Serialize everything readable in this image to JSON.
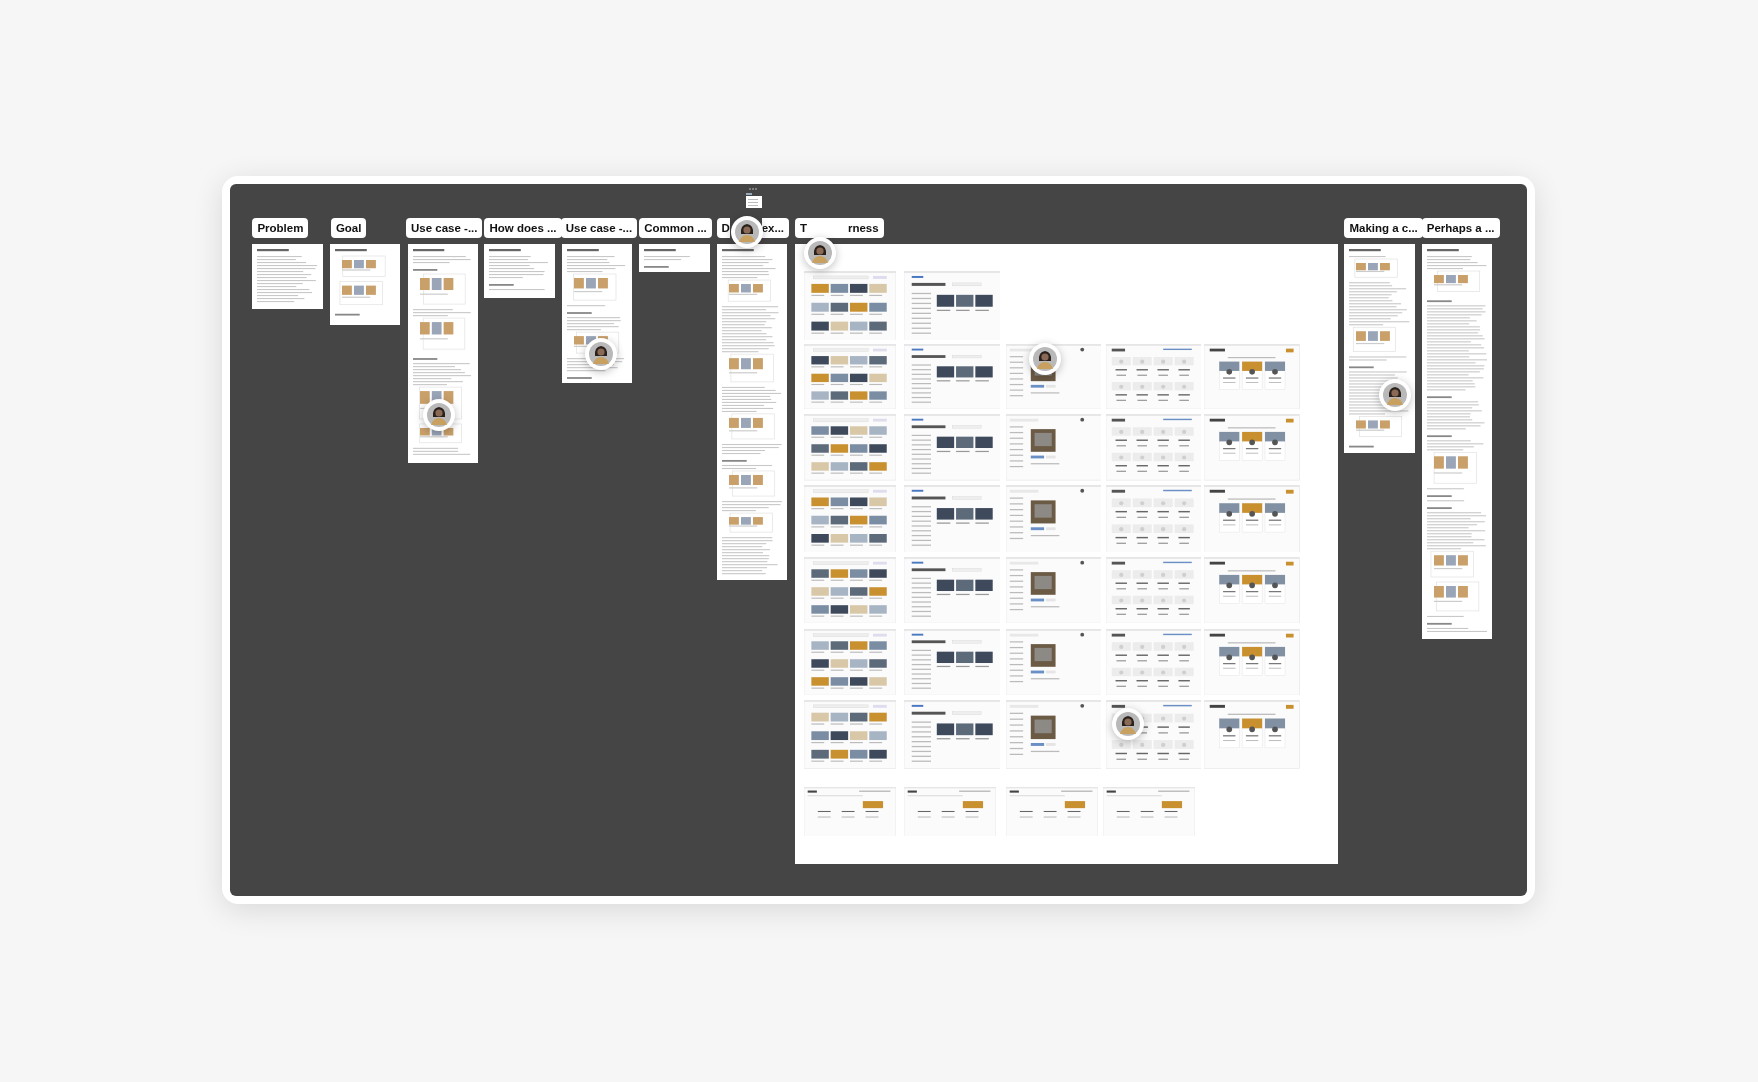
{
  "frames": [
    {
      "title": "Problem",
      "kind": "document"
    },
    {
      "title": "Goal",
      "kind": "document"
    },
    {
      "title": "Use case -...",
      "kind": "document"
    },
    {
      "title": "How does ...",
      "kind": "document"
    },
    {
      "title": "Use case -...",
      "kind": "document"
    },
    {
      "title": "Common ...",
      "kind": "document"
    },
    {
      "title_parts": [
        "D",
        "ex..."
      ],
      "kind": "document"
    },
    {
      "title_parts": [
        "T",
        "rness"
      ],
      "kind": "screens"
    },
    {
      "title": "Making a c...",
      "kind": "document"
    },
    {
      "title": "Perhaps a ...",
      "kind": "document"
    }
  ]
}
